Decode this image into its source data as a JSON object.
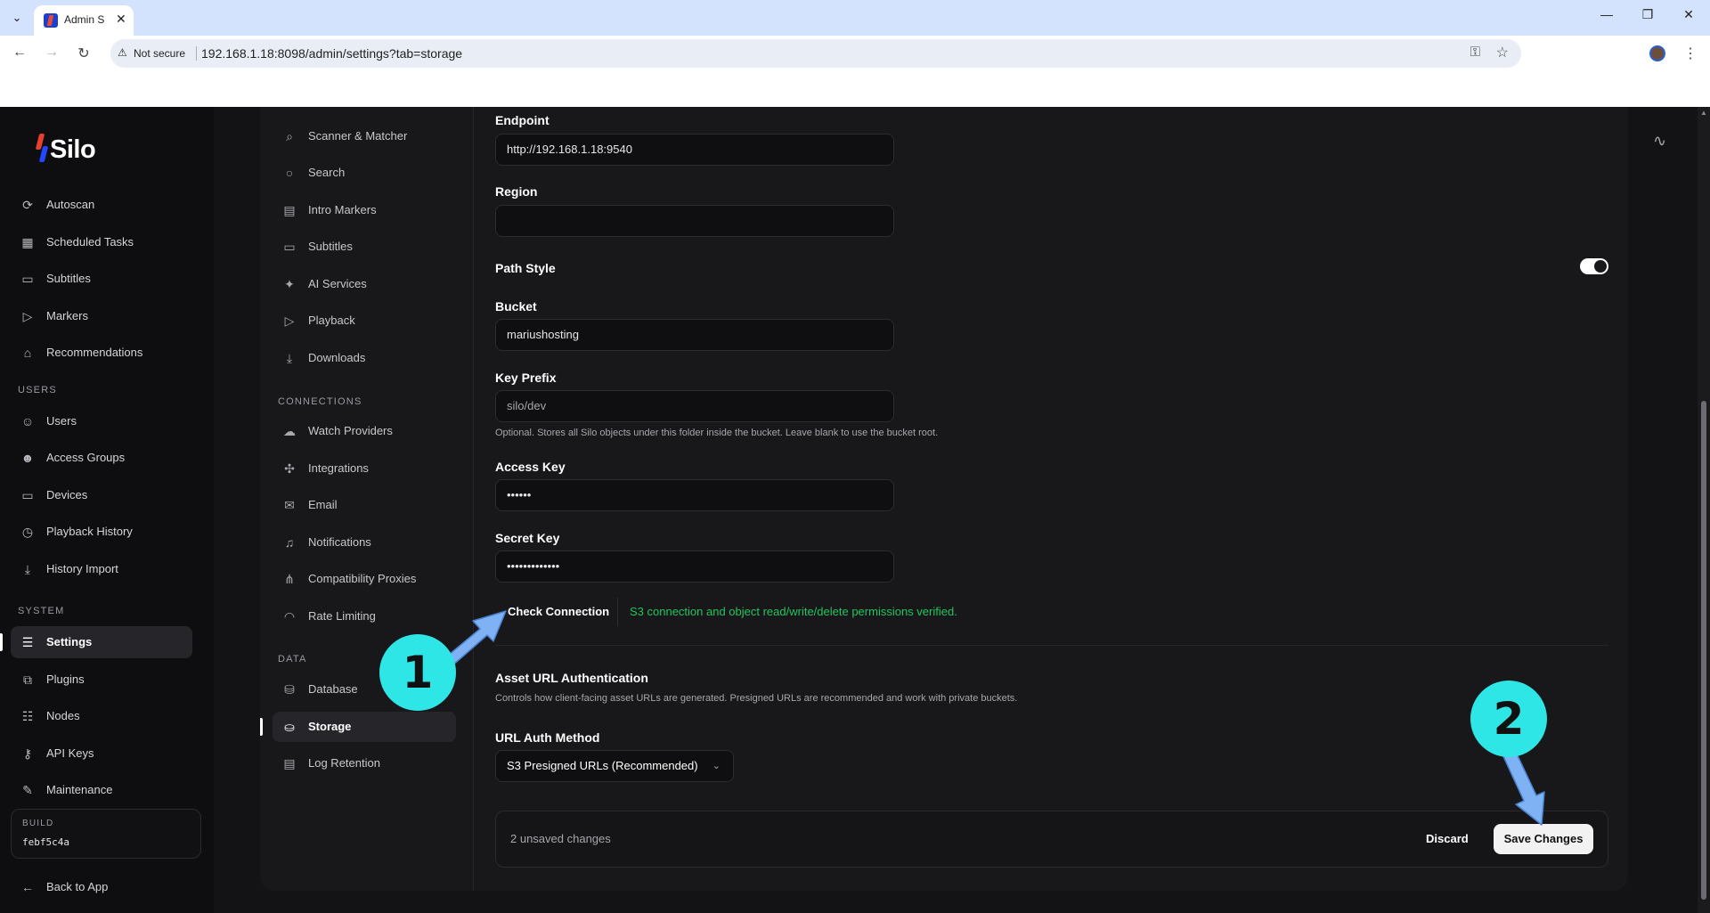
{
  "browser": {
    "tab_title": "Admin S",
    "not_secure_label": "Not secure",
    "url": "192.168.1.18:8098/admin/settings?tab=storage"
  },
  "app": {
    "logo_text": "Silo",
    "main_nav": [
      {
        "label": "Autoscan",
        "icon": "scan-icon"
      },
      {
        "label": "Scheduled Tasks",
        "icon": "calendar-icon"
      },
      {
        "label": "Subtitles",
        "icon": "subtitles-icon"
      },
      {
        "label": "Markers",
        "icon": "marker-icon"
      },
      {
        "label": "Recommendations",
        "icon": "recommend-icon"
      }
    ],
    "users_section": "USERS",
    "users_nav": [
      {
        "label": "Users",
        "icon": "user-icon"
      },
      {
        "label": "Access Groups",
        "icon": "group-icon"
      },
      {
        "label": "Devices",
        "icon": "device-icon"
      },
      {
        "label": "Playback History",
        "icon": "history-icon"
      },
      {
        "label": "History Import",
        "icon": "import-icon"
      }
    ],
    "system_section": "SYSTEM",
    "system_nav": [
      {
        "label": "Settings",
        "icon": "sliders-icon",
        "active": true
      },
      {
        "label": "Plugins",
        "icon": "plugin-icon"
      },
      {
        "label": "Nodes",
        "icon": "nodes-icon"
      },
      {
        "label": "API Keys",
        "icon": "key-icon"
      },
      {
        "label": "Maintenance",
        "icon": "wrench-icon"
      }
    ],
    "build_label": "BUILD",
    "build_value": "febf5c4a",
    "back_to_app": "Back to App"
  },
  "settings_nav": {
    "top_items": [
      {
        "label": "Scanner & Matcher"
      },
      {
        "label": "Search"
      },
      {
        "label": "Intro Markers"
      },
      {
        "label": "Subtitles"
      },
      {
        "label": "AI Services"
      },
      {
        "label": "Playback"
      },
      {
        "label": "Downloads"
      }
    ],
    "connections_section": "CONNECTIONS",
    "connections_items": [
      {
        "label": "Watch Providers"
      },
      {
        "label": "Integrations"
      },
      {
        "label": "Email"
      },
      {
        "label": "Notifications"
      },
      {
        "label": "Compatibility Proxies"
      },
      {
        "label": "Rate Limiting"
      }
    ],
    "data_section": "DATA",
    "data_items": [
      {
        "label": "Database"
      },
      {
        "label": "Storage",
        "active": true
      },
      {
        "label": "Log Retention"
      }
    ]
  },
  "form": {
    "endpoint_label": "Endpoint",
    "endpoint_value": "http://192.168.1.18:9540",
    "region_label": "Region",
    "region_value": "",
    "path_style_label": "Path Style",
    "path_style_on": true,
    "bucket_label": "Bucket",
    "bucket_value": "mariushosting",
    "key_prefix_label": "Key Prefix",
    "key_prefix_value": "silo/dev",
    "key_prefix_help": "Optional. Stores all Silo objects under this folder inside the bucket. Leave blank to use the bucket root.",
    "access_key_label": "Access Key",
    "access_key_value": "••••••",
    "secret_key_label": "Secret Key",
    "secret_key_value": "•••••••••••••",
    "check_connection_label": "Check Connection",
    "check_status": "S3 connection and object read/write/delete permissions verified.",
    "check_status_color": "#22c55e",
    "asset_auth_title": "Asset URL Authentication",
    "asset_auth_help": "Controls how client-facing asset URLs are generated. Presigned URLs are recommended and work with private buckets.",
    "url_auth_method_label": "URL Auth Method",
    "url_auth_method_value": "S3 Presigned URLs (Recommended)"
  },
  "save_bar": {
    "unsaved": "2 unsaved changes",
    "discard": "Discard",
    "save": "Save Changes"
  },
  "annotations": {
    "badge_1": "1",
    "badge_2": "2",
    "badge_color": "#2ee6e6",
    "arrow_color": "#7fb1f5"
  }
}
